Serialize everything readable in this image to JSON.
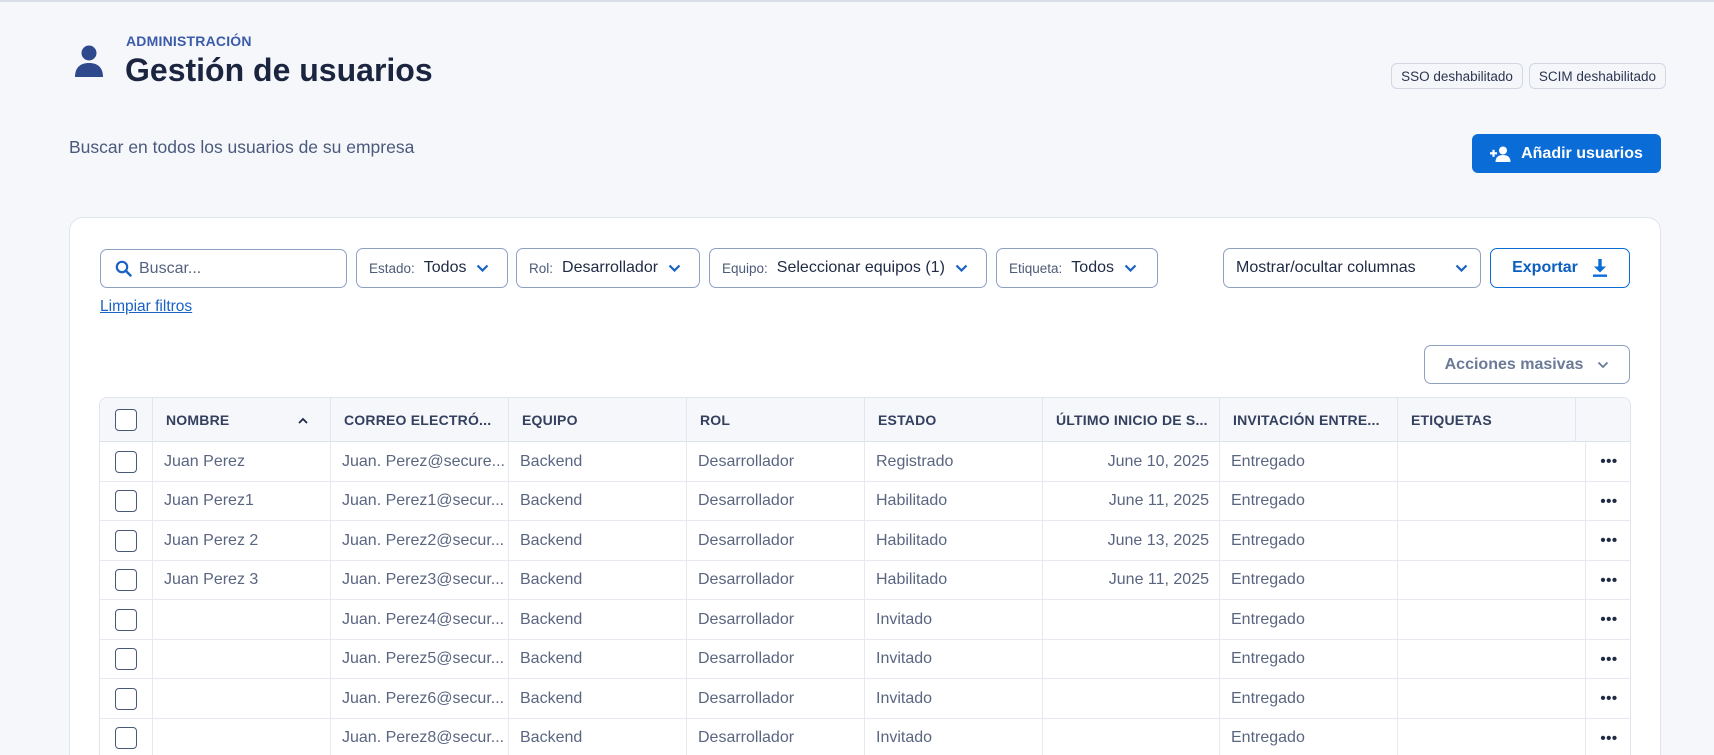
{
  "header": {
    "eyebrow": "ADMINISTRACIÓN",
    "title": "Gestión de usuarios",
    "badges": [
      "SSO deshabilitado",
      "SCIM deshabilitado"
    ]
  },
  "subtitle": "Buscar en todos los usuarios de su empresa",
  "add_button": "Añadir usuarios",
  "filters": {
    "search_placeholder": "Buscar...",
    "estado": {
      "label": "Estado:",
      "value": "Todos"
    },
    "rol": {
      "label": "Rol:",
      "value": "Desarrollador"
    },
    "equipo": {
      "label": "Equipo:",
      "value": "Seleccionar equipos (1)"
    },
    "etiqueta": {
      "label": "Etiqueta:",
      "value": "Todos"
    },
    "columns": "Mostrar/ocultar columnas",
    "export": "Exportar",
    "clear": "Limpiar filtros"
  },
  "bulk_actions": "Acciones masivas",
  "table": {
    "columns": [
      "NOMBRE",
      "CORREO ELECTRÓ...",
      "EQUIPO",
      "ROL",
      "ESTADO",
      "ÚLTIMO INICIO DE S...",
      "INVITACIÓN ENTRE...",
      "ETIQUETAS"
    ],
    "rows": [
      [
        "Juan Perez",
        "Juan. Perez@secure...",
        "Backend",
        "Desarrollador",
        "Registrado",
        "June 10, 2025",
        "Entregado",
        ""
      ],
      [
        "Juan Perez1",
        "Juan. Perez1@secur...",
        "Backend",
        "Desarrollador",
        "Habilitado",
        "June 11, 2025",
        "Entregado",
        ""
      ],
      [
        "Juan Perez 2",
        "Juan. Perez2@secur...",
        "Backend",
        "Desarrollador",
        "Habilitado",
        "June 13, 2025",
        "Entregado",
        ""
      ],
      [
        "Juan Perez 3",
        "Juan. Perez3@secur...",
        "Backend",
        "Desarrollador",
        "Habilitado",
        "June 11, 2025",
        "Entregado",
        ""
      ],
      [
        "",
        "Juan. Perez4@secur...",
        "Backend",
        "Desarrollador",
        "Invitado",
        "",
        "Entregado",
        ""
      ],
      [
        "",
        "Juan. Perez5@secur...",
        "Backend",
        "Desarrollador",
        "Invitado",
        "",
        "Entregado",
        ""
      ],
      [
        "",
        "Juan. Perez6@secur...",
        "Backend",
        "Desarrollador",
        "Invitado",
        "",
        "Entregado",
        ""
      ],
      [
        "",
        "Juan. Perez8@secur...",
        "Backend",
        "Desarrollador",
        "Invitado",
        "",
        "Entregado",
        ""
      ]
    ],
    "row_menu": "•••"
  },
  "colors": {
    "accent": "#0a6cd6",
    "text": "#1f2a44",
    "background": "#f6f7fb"
  }
}
